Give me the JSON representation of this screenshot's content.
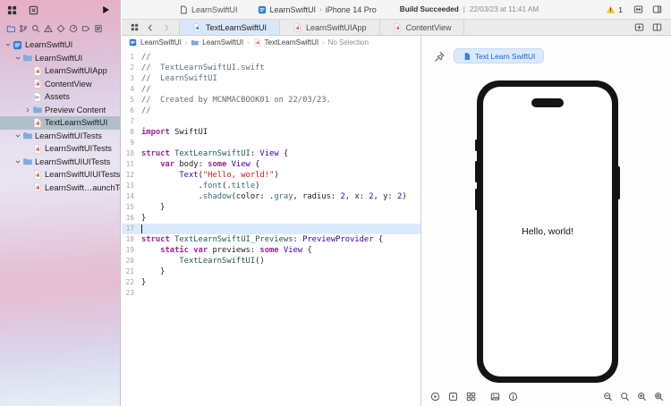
{
  "titlebar": {
    "window_title": "LearnSwiftUI",
    "scheme": "LearnSwiftUI",
    "run_destination": "iPhone 14 Pro",
    "build_status": "Build Succeeded",
    "status_separator": "|",
    "build_time": "22/03/23 at 11:41 AM",
    "warning_count": "1"
  },
  "navigator": {
    "tabs": [
      "project",
      "source-control",
      "search",
      "issues",
      "tests",
      "debug",
      "breakpoints",
      "reports"
    ],
    "selected_tab": "project",
    "items": [
      {
        "label": "LearnSwiftUI",
        "depth": 0,
        "icon": "proj",
        "chevron": "down"
      },
      {
        "label": "LearnSwiftUI",
        "depth": 1,
        "icon": "folder",
        "chevron": "down"
      },
      {
        "label": "LearnSwiftUIApp",
        "depth": 2,
        "icon": "swift"
      },
      {
        "label": "ContentView",
        "depth": 2,
        "icon": "swift"
      },
      {
        "label": "Assets",
        "depth": 2,
        "icon": "assets"
      },
      {
        "label": "Preview Content",
        "depth": 2,
        "icon": "folder",
        "chevron": "right"
      },
      {
        "label": "TextLearnSwiftUI",
        "depth": 2,
        "icon": "swift",
        "selected": true
      },
      {
        "label": "LearnSwiftUITests",
        "depth": 1,
        "icon": "folder",
        "chevron": "down"
      },
      {
        "label": "LearnSwiftUITests",
        "depth": 2,
        "icon": "swift"
      },
      {
        "label": "LearnSwiftUIUITests",
        "depth": 1,
        "icon": "folder",
        "chevron": "down"
      },
      {
        "label": "LearnSwiftUIUITests",
        "depth": 2,
        "icon": "swift"
      },
      {
        "label": "LearnSwift…aunchTests",
        "depth": 2,
        "icon": "swift"
      }
    ]
  },
  "editor_tabs": [
    {
      "label": "TextLearnSwiftUI",
      "icon": "swift-blue",
      "active": true
    },
    {
      "label": "LearnSwiftUIApp",
      "icon": "swift",
      "active": false
    },
    {
      "label": "ContentView",
      "icon": "swift",
      "active": false
    }
  ],
  "jump_bar": {
    "items": [
      {
        "label": "LearnSwiftUI",
        "icon": "proj"
      },
      {
        "label": "LearnSwiftUI",
        "icon": "folder"
      },
      {
        "label": "TextLearnSwiftUI",
        "icon": "swift"
      },
      {
        "label": "No Selection",
        "muted": true
      }
    ]
  },
  "editor": {
    "current_line": 17,
    "lines": [
      {
        "n": 1,
        "segs": [
          [
            "c",
            "//"
          ]
        ]
      },
      {
        "n": 2,
        "segs": [
          [
            "c",
            "//  TextLearnSwiftUI.swift"
          ]
        ]
      },
      {
        "n": 3,
        "segs": [
          [
            "c",
            "//  LearnSwiftUI"
          ]
        ]
      },
      {
        "n": 4,
        "segs": [
          [
            "c",
            "//"
          ]
        ]
      },
      {
        "n": 5,
        "segs": [
          [
            "c",
            "//  Created by MCNMACBOOK01 on 22/03/23."
          ]
        ]
      },
      {
        "n": 6,
        "segs": [
          [
            "c",
            "//"
          ]
        ]
      },
      {
        "n": 7,
        "segs": []
      },
      {
        "n": 8,
        "segs": [
          [
            "k",
            "import"
          ],
          [
            "p",
            " SwiftUI"
          ]
        ]
      },
      {
        "n": 9,
        "segs": []
      },
      {
        "n": 10,
        "segs": [
          [
            "k",
            "struct"
          ],
          [
            "p",
            " "
          ],
          [
            "t1",
            "TextLearnSwiftUI"
          ],
          [
            "p",
            ": "
          ],
          [
            "t2",
            "View"
          ],
          [
            "p",
            " {"
          ]
        ]
      },
      {
        "n": 11,
        "segs": [
          [
            "p",
            "    "
          ],
          [
            "k",
            "var"
          ],
          [
            "p",
            " body: "
          ],
          [
            "k",
            "some"
          ],
          [
            "p",
            " "
          ],
          [
            "t2",
            "View"
          ],
          [
            "p",
            " {"
          ]
        ]
      },
      {
        "n": 12,
        "segs": [
          [
            "p",
            "        "
          ],
          [
            "t2",
            "Text"
          ],
          [
            "p",
            "("
          ],
          [
            "s",
            "\"Hello, world!\""
          ],
          [
            "p",
            ")"
          ]
        ]
      },
      {
        "n": 13,
        "segs": [
          [
            "p",
            "            ."
          ],
          [
            "m",
            "font"
          ],
          [
            "p",
            "(."
          ],
          [
            "m",
            "title"
          ],
          [
            "p",
            ")"
          ]
        ]
      },
      {
        "n": 14,
        "segs": [
          [
            "p",
            "            ."
          ],
          [
            "m",
            "shadow"
          ],
          [
            "p",
            "(color: ."
          ],
          [
            "m",
            "gray"
          ],
          [
            "p",
            ", radius: "
          ],
          [
            "num",
            "2"
          ],
          [
            "p",
            ", x: "
          ],
          [
            "num",
            "2"
          ],
          [
            "p",
            ", y: "
          ],
          [
            "num",
            "2"
          ],
          [
            "p",
            ")"
          ]
        ]
      },
      {
        "n": 15,
        "segs": [
          [
            "p",
            "    }"
          ]
        ]
      },
      {
        "n": 16,
        "segs": [
          [
            "p",
            "}"
          ]
        ]
      },
      {
        "n": 17,
        "segs": []
      },
      {
        "n": 18,
        "segs": [
          [
            "k",
            "struct"
          ],
          [
            "p",
            " "
          ],
          [
            "t1",
            "TextLearnSwiftUI_Previews"
          ],
          [
            "p",
            ": "
          ],
          [
            "t2",
            "PreviewProvider"
          ],
          [
            "p",
            " {"
          ]
        ]
      },
      {
        "n": 19,
        "segs": [
          [
            "p",
            "    "
          ],
          [
            "k",
            "static"
          ],
          [
            "p",
            " "
          ],
          [
            "k",
            "var"
          ],
          [
            "p",
            " previews: "
          ],
          [
            "k",
            "some"
          ],
          [
            "p",
            " "
          ],
          [
            "t2",
            "View"
          ],
          [
            "p",
            " {"
          ]
        ]
      },
      {
        "n": 20,
        "segs": [
          [
            "p",
            "        "
          ],
          [
            "t1",
            "TextLearnSwiftUI"
          ],
          [
            "p",
            "()"
          ]
        ]
      },
      {
        "n": 21,
        "segs": [
          [
            "p",
            "    }"
          ]
        ]
      },
      {
        "n": 22,
        "segs": [
          [
            "p",
            "}"
          ]
        ]
      },
      {
        "n": 23,
        "segs": []
      }
    ]
  },
  "canvas": {
    "preview_name": "Text Learn SwiftUI",
    "device_screen_text": "Hello, world!",
    "toolbar": {
      "left": [
        "live-preview",
        "selectable-mode",
        "variants"
      ],
      "middle": [
        "color-scheme",
        "device-settings"
      ],
      "right": [
        "zoom-out",
        "zoom-actual",
        "zoom-in",
        "zoom-fit"
      ]
    }
  },
  "colors": {
    "accent": "#1166d5",
    "swift_orange": "#f05138",
    "tab_active_bg": "#d9e7f9",
    "selection_bg": "#b2bfcb",
    "warning_yellow": "#f8c735"
  }
}
